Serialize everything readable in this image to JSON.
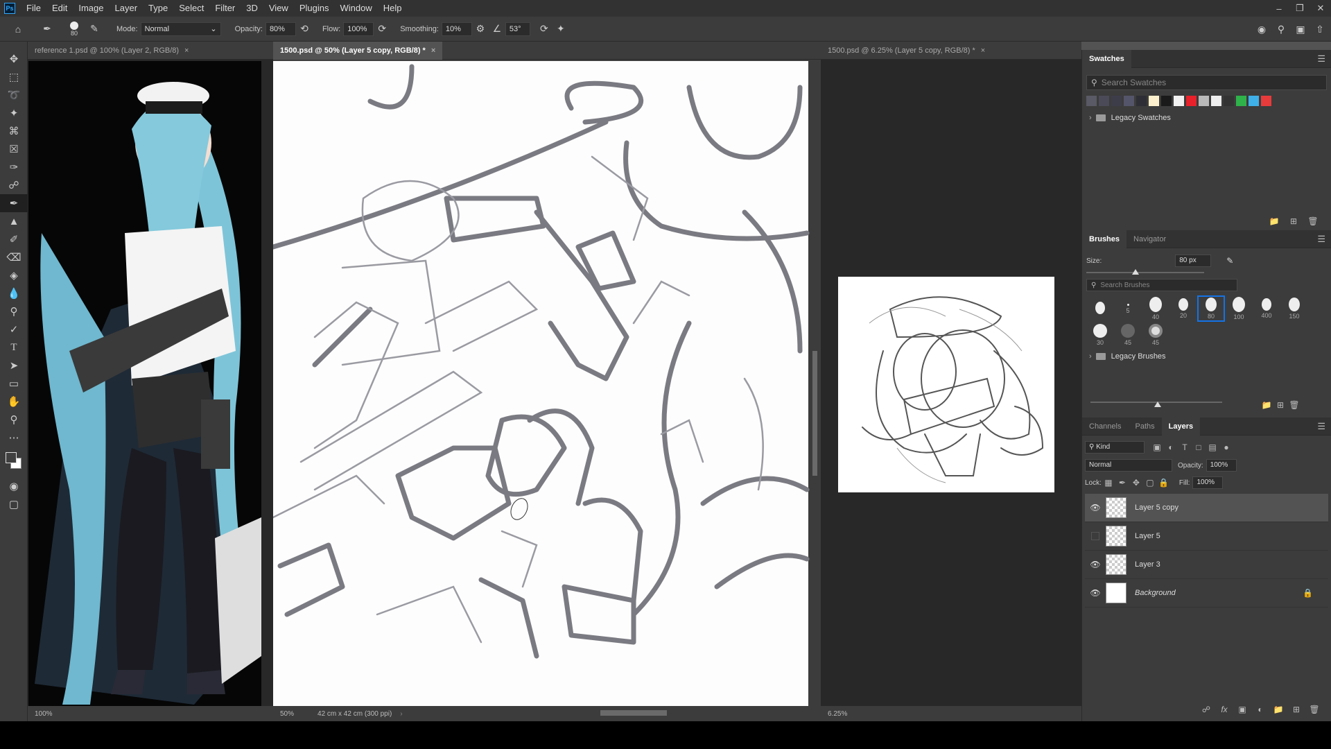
{
  "app": {
    "logo": "Ps"
  },
  "menu": [
    "File",
    "Edit",
    "Image",
    "Layer",
    "Type",
    "Select",
    "Filter",
    "3D",
    "View",
    "Plugins",
    "Window",
    "Help"
  ],
  "window_controls": [
    "minimize-icon",
    "restore-icon",
    "close-icon"
  ],
  "options": {
    "brush_size": "80",
    "mode_label": "Mode:",
    "mode_value": "Normal",
    "opacity_label": "Opacity:",
    "opacity_value": "80%",
    "flow_label": "Flow:",
    "flow_value": "100%",
    "smoothing_label": "Smoothing:",
    "smoothing_value": "10%",
    "angle_value": "53°"
  },
  "tabs": {
    "reference": "reference 1.psd @ 100% (Layer 2, RGB/8)",
    "main": "1500.psd @ 50% (Layer 5 copy, RGB/8) *",
    "preview": "1500.psd @ 6.25% (Layer 5 copy, RGB/8) *"
  },
  "status": {
    "reference_zoom": "100%",
    "main_zoom": "50%",
    "main_doc_size": "42 cm x 42 cm (300 ppi)",
    "preview_zoom": "6.25%"
  },
  "swatches": {
    "title": "Swatches",
    "search_placeholder": "Search Swatches",
    "colors": [
      "#5a5a66",
      "#4a4a58",
      "#3d3d4a",
      "#54546a",
      "#2e2e36",
      "#fdf0cc",
      "#1a1a1a",
      "#f1f1f1",
      "#e8212a",
      "#b9b9b9",
      "#eeeeee",
      "#333333",
      "#2fb24a",
      "#3fb0e8",
      "#e73b3b"
    ],
    "folder": "Legacy Swatches"
  },
  "brushes": {
    "tabs": [
      "Brushes",
      "Navigator"
    ],
    "size_label": "Size:",
    "size_value": "80 px",
    "search_placeholder": "Search Brushes",
    "row1": [
      "",
      "5",
      "40",
      "20",
      "80",
      "100",
      "400",
      "150"
    ],
    "row2": [
      "30",
      "45",
      "45"
    ],
    "selected": "80",
    "folder": "Legacy Brushes"
  },
  "layers_panel": {
    "tabs": [
      "Channels",
      "Paths",
      "Layers"
    ],
    "kind_label": "Kind",
    "blend_mode": "Normal",
    "opacity_label": "Opacity:",
    "opacity_value": "100%",
    "lock_label": "Lock:",
    "fill_label": "Fill:",
    "fill_value": "100%",
    "layers": [
      {
        "name": "Layer 5 copy",
        "visible": true,
        "active": true
      },
      {
        "name": "Layer 5",
        "visible": false,
        "active": false
      },
      {
        "name": "Layer 3",
        "visible": true,
        "active": false
      },
      {
        "name": "Background",
        "visible": true,
        "active": false,
        "locked": true
      }
    ]
  }
}
